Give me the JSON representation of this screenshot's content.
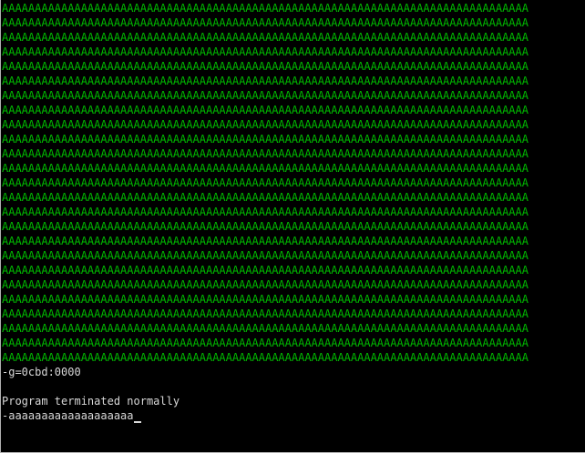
{
  "console": {
    "fill_char": "A",
    "fill_color": "#00b800",
    "text_color": "#d8d8d8",
    "background": "#000000",
    "fill_row_count": 25,
    "fill_row_length": 80,
    "lines_after_fill": [
      "-g=0cbd:0000",
      "",
      "Program terminated normally",
      "-aaaaaaaaaaaaaaaaaaa"
    ]
  }
}
